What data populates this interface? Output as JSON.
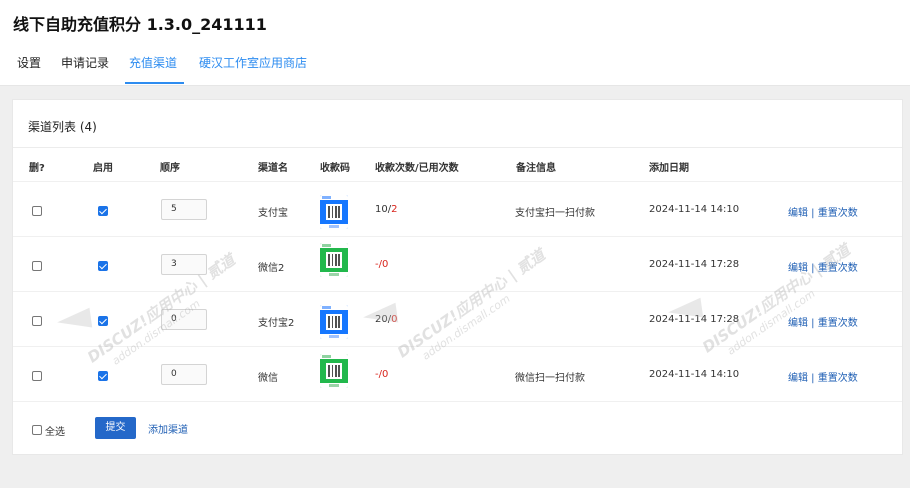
{
  "app": {
    "title": "线下自助充值积分 1.3.0_241111"
  },
  "tabs": [
    {
      "label": "设置",
      "active": false
    },
    {
      "label": "申请记录",
      "active": false
    },
    {
      "label": "充值渠道",
      "active": true
    },
    {
      "label": "硬汉工作室应用商店",
      "active": false
    }
  ],
  "panel": {
    "title": "渠道列表 (4)"
  },
  "table": {
    "headers": {
      "delete": "删?",
      "enabled": "启用",
      "order": "顺序",
      "name": "渠道名",
      "qr": "收款码",
      "counts": "收款次数/已用次数",
      "note": "备注信息",
      "date": "添加日期"
    },
    "rows": [
      {
        "delete": false,
        "enabled": true,
        "order": "5",
        "name": "支付宝",
        "qr_type": "alipay-qr-icon",
        "received": "10",
        "used": "2",
        "note": "支付宝扫一扫付款",
        "date": "2024-11-14 14:10",
        "edit": "编辑",
        "reset": "重置次数"
      },
      {
        "delete": false,
        "enabled": true,
        "order": "3",
        "name": "微信2",
        "qr_type": "wechat-qr-icon",
        "received": "-",
        "used": "0",
        "note": "",
        "date": "2024-11-14 17:28",
        "edit": "编辑",
        "reset": "重置次数"
      },
      {
        "delete": false,
        "enabled": true,
        "order": "0",
        "name": "支付宝2",
        "qr_type": "alipay-qr-icon",
        "received": "20",
        "used": "0",
        "note": "",
        "date": "2024-11-14 17:28",
        "edit": "编辑",
        "reset": "重置次数"
      },
      {
        "delete": false,
        "enabled": true,
        "order": "0",
        "name": "微信",
        "qr_type": "wechat-qr-icon",
        "received": "-",
        "used": "0",
        "note": "微信扫一扫付款",
        "date": "2024-11-14 14:10",
        "edit": "编辑",
        "reset": "重置次数"
      }
    ]
  },
  "footer": {
    "select_all_label": "全选",
    "submit_label": "提交",
    "add_channel_label": "添加渠道"
  },
  "watermark": {
    "brand": "DISCUZ!应用中心 | 贰道",
    "domain": "addon.dismall.com"
  },
  "colors": {
    "accent": "#2d8cf0",
    "link": "#1f5fb4",
    "used_count": "#d9251d",
    "button": "#2468c9",
    "alipay": "#1677ff",
    "wechat": "#22b84c"
  }
}
